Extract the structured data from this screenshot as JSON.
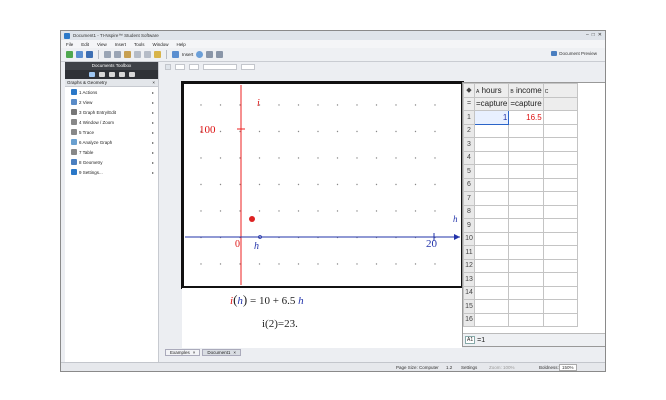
{
  "window": {
    "title": "Document1 - TI-Nspire™ Student Software",
    "controls": [
      "–",
      "□",
      "✕"
    ]
  },
  "menu": [
    "File",
    "Edit",
    "View",
    "Insert",
    "Tools",
    "Window",
    "Help"
  ],
  "toolbar": {
    "insert_label": "Insert",
    "doc_preview_label": "Document Preview"
  },
  "sidebar": {
    "header": "Documents Toolbox",
    "section_title": "Graphs & Geometry",
    "section_close": "×",
    "items": [
      {
        "label": "1 Actions",
        "icon": "cursor-arrow-icon",
        "color": "#2a78c8"
      },
      {
        "label": "2 View",
        "icon": "view-icon",
        "color": "#5a8cc8"
      },
      {
        "label": "3 Graph Entry/Edit",
        "icon": "graph-entry-icon",
        "color": "#777777"
      },
      {
        "label": "4 Window / Zoom",
        "icon": "window-zoom-icon",
        "color": "#888888"
      },
      {
        "label": "5 Trace",
        "icon": "trace-icon",
        "color": "#888888"
      },
      {
        "label": "6 Analyze Graph",
        "icon": "analyze-graph-icon",
        "color": "#6aa0d0"
      },
      {
        "label": "7 Table",
        "icon": "table-icon",
        "color": "#888888"
      },
      {
        "label": "8 Geometry",
        "icon": "geometry-icon",
        "color": "#4a7fc0"
      },
      {
        "label": "9 Settings...",
        "icon": "settings-icon",
        "color": "#2a78c8"
      }
    ]
  },
  "graph": {
    "y_axis_label": "i",
    "x_axis_label": "h",
    "y_tick_label": "100",
    "x_tick_label": "20",
    "origin_label": "0",
    "point_label": "h",
    "point_color": "#dd2222"
  },
  "notes": {
    "line1": {
      "fn": "i",
      "arg": "h",
      "rhs": "= 10 + 6.5",
      "var": "h"
    },
    "line2": "i(2)=23."
  },
  "spreadsheet": {
    "column_headers": [
      {
        "letter": "A",
        "name": "hours"
      },
      {
        "letter": "B",
        "name": "income"
      },
      {
        "letter": "C",
        "name": ""
      }
    ],
    "formula_row": {
      "marker": "=",
      "cells": [
        "=capture",
        "=capture",
        ""
      ]
    },
    "rows": [
      {
        "num": "1",
        "cells": [
          "1",
          "16.5",
          ""
        ]
      },
      {
        "num": "2",
        "cells": [
          "",
          "",
          ""
        ]
      },
      {
        "num": "3",
        "cells": [
          "",
          "",
          ""
        ]
      },
      {
        "num": "4",
        "cells": [
          "",
          "",
          ""
        ]
      },
      {
        "num": "5",
        "cells": [
          "",
          "",
          ""
        ]
      },
      {
        "num": "6",
        "cells": [
          "",
          "",
          ""
        ]
      },
      {
        "num": "7",
        "cells": [
          "",
          "",
          ""
        ]
      },
      {
        "num": "8",
        "cells": [
          "",
          "",
          ""
        ]
      },
      {
        "num": "9",
        "cells": [
          "",
          "",
          ""
        ]
      },
      {
        "num": "10",
        "cells": [
          "",
          "",
          ""
        ]
      },
      {
        "num": "11",
        "cells": [
          "",
          "",
          ""
        ]
      },
      {
        "num": "12",
        "cells": [
          "",
          "",
          ""
        ]
      },
      {
        "num": "13",
        "cells": [
          "",
          "",
          ""
        ]
      },
      {
        "num": "14",
        "cells": [
          "",
          "",
          ""
        ]
      },
      {
        "num": "15",
        "cells": [
          "",
          "",
          ""
        ]
      },
      {
        "num": "16",
        "cells": [
          "",
          "",
          ""
        ]
      }
    ],
    "entry_label": "A1",
    "entry_value": "=1"
  },
  "tabs": [
    {
      "label": "Examples",
      "close": "×"
    },
    {
      "label": "Document1",
      "close": "×"
    }
  ],
  "status": {
    "page_size": "Page Size: Computer",
    "page_ratio": "1.2",
    "settings": "Settings",
    "zoom": "Zoom: 100%",
    "boldness": "Boldness:",
    "boldness_value": "150%"
  }
}
